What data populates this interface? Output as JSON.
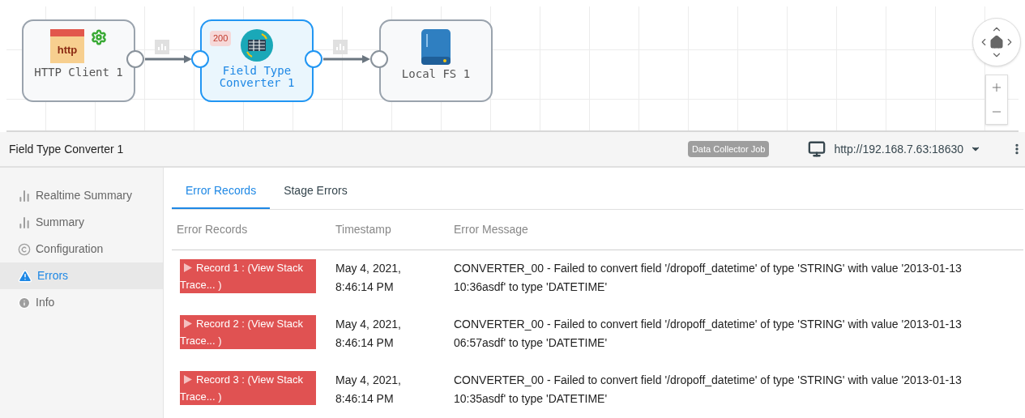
{
  "canvas": {
    "nodes": [
      {
        "label": "HTTP Client 1",
        "kind": "http",
        "icon_text": "http",
        "selected": false
      },
      {
        "label": "Field Type Converter 1",
        "kind": "converter",
        "badge": "200",
        "selected": true
      },
      {
        "label": "Local FS 1",
        "kind": "storage",
        "selected": false
      }
    ]
  },
  "header": {
    "title": "Field Type Converter 1",
    "badge": "Data Collector Job",
    "url": "http://192.168.7.63:18630"
  },
  "sidebar": {
    "items": [
      {
        "label": "Realtime Summary",
        "kind": "bars",
        "selected": false
      },
      {
        "label": "Summary",
        "kind": "bars",
        "selected": false
      },
      {
        "label": "Configuration",
        "kind": "copyright",
        "selected": false
      },
      {
        "label": "Errors",
        "kind": "warning",
        "selected": true
      },
      {
        "label": "Info",
        "kind": "info",
        "selected": false
      }
    ]
  },
  "tabs": [
    {
      "label": "Error Records",
      "selected": true
    },
    {
      "label": "Stage Errors",
      "selected": false
    }
  ],
  "table": {
    "columns": [
      "Error Records",
      "Timestamp",
      "Error Message"
    ],
    "rows": [
      {
        "record": "Record 1 : (View Stack Trace... )",
        "timestamp": "May 4, 2021, 8:46:14 PM",
        "message": "CONVERTER_00 - Failed to convert field '/dropoff_datetime' of type 'STRING' with value '2013-01-13 10:36asdf' to type 'DATETIME'"
      },
      {
        "record": "Record 2 : (View Stack Trace... )",
        "timestamp": "May 4, 2021, 8:46:14 PM",
        "message": "CONVERTER_00 - Failed to convert field '/dropoff_datetime' of type 'STRING' with value '2013-01-13 06:57asdf' to type 'DATETIME'"
      },
      {
        "record": "Record 3 : (View Stack Trace... )",
        "timestamp": "May 4, 2021, 8:46:14 PM",
        "message": "CONVERTER_00 - Failed to convert field '/dropoff_datetime' of type 'STRING' with value '2013-01-13 10:35asdf' to type 'DATETIME'"
      }
    ]
  }
}
